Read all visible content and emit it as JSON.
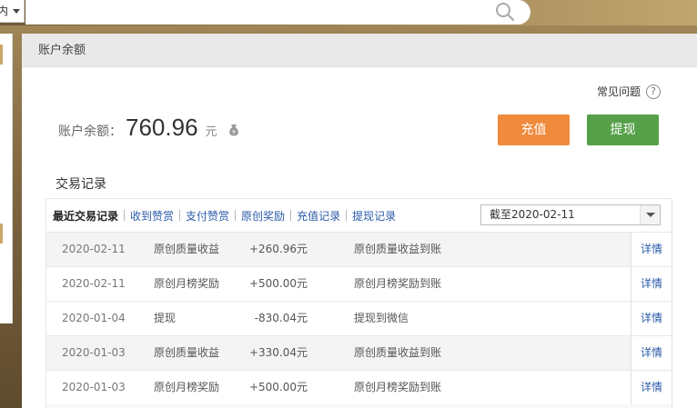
{
  "topbar": {
    "scope_label": "内",
    "search_placeholder": ""
  },
  "panel": {
    "title": "账户余额",
    "faq_label": "常见问题",
    "faq_icon": "?",
    "balance_label": "账户余额：",
    "balance_amount": "760.96",
    "balance_unit": "元",
    "recharge_label": "充值",
    "withdraw_label": "提现",
    "records_title": "交易记录"
  },
  "tabs": [
    {
      "label": "最近交易记录",
      "active": true
    },
    {
      "label": "收到赞赏",
      "active": false
    },
    {
      "label": "支付赞赏",
      "active": false
    },
    {
      "label": "原创奖励",
      "active": false
    },
    {
      "label": "充值记录",
      "active": false
    },
    {
      "label": "提现记录",
      "active": false
    }
  ],
  "date_filter": {
    "selected": "截至2020-02-11"
  },
  "rows": [
    {
      "date": "2020-02-11",
      "type": "原创质量收益",
      "amount": "+260.96元",
      "desc": "原创质量收益到账",
      "detail": "详情"
    },
    {
      "date": "2020-02-11",
      "type": "原创月榜奖励",
      "amount": "+500.00元",
      "desc": "原创月榜奖励到账",
      "detail": "详情"
    },
    {
      "date": "2020-01-04",
      "type": "提现",
      "amount": "-830.04元",
      "desc": "提现到微信",
      "detail": "详情"
    },
    {
      "date": "2020-01-03",
      "type": "原创质量收益",
      "amount": "+330.04元",
      "desc": "原创质量收益到账",
      "detail": "详情"
    },
    {
      "date": "2020-01-03",
      "type": "原创月榜奖励",
      "amount": "+500.00元",
      "desc": "原创月榜奖励到账",
      "detail": "详情"
    }
  ],
  "colors": {
    "recharge_button": "#f08a3c",
    "withdraw_button": "#55a048",
    "link": "#2a5aa8"
  }
}
